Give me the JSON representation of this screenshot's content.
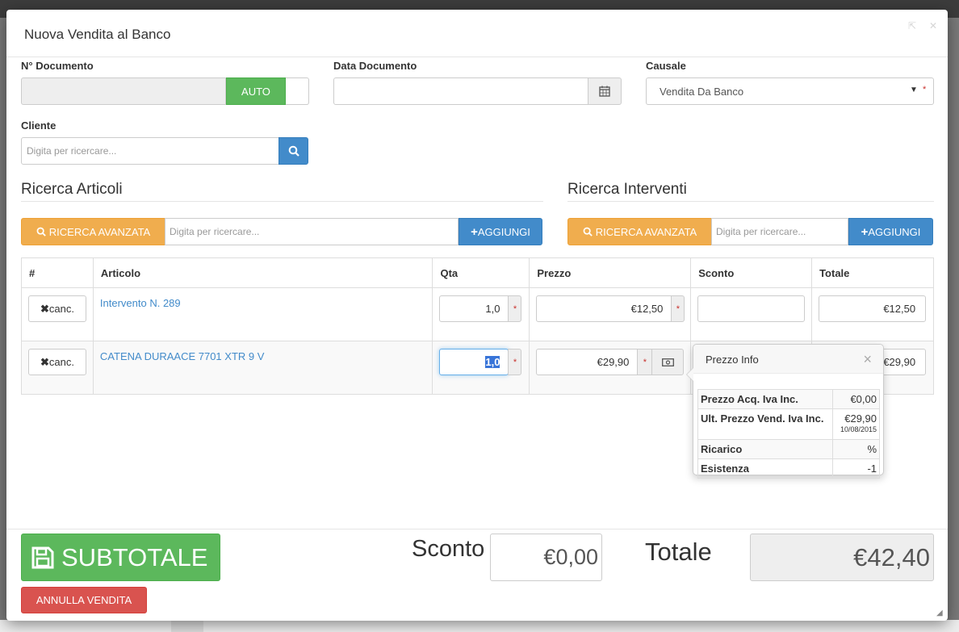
{
  "modal": {
    "title": "Nuova Vendita al Banco"
  },
  "form": {
    "doc_number_label": "N° Documento",
    "doc_number_value": "",
    "auto_label": "AUTO",
    "doc_date_label": "Data Documento",
    "doc_date_value": "",
    "causale_label": "Causale",
    "causale_value": "Vendita Da Banco",
    "required_mark": "*",
    "cliente_label": "Cliente",
    "cliente_placeholder": "Digita per ricercare..."
  },
  "articoli": {
    "title": "Ricerca Articoli",
    "search_button": "RICERCA AVANZATA",
    "placeholder": "Digita per ricercare...",
    "add_button": "AGGIUNGI"
  },
  "interventi": {
    "title": "Ricerca Interventi",
    "search_button": "RICERCA AVANZATA",
    "placeholder": "Digita per ricercare...",
    "add_button": "AGGIUNGI"
  },
  "table": {
    "headers": [
      "#",
      "Articolo",
      "Qta",
      "Prezzo",
      "Sconto",
      "Totale"
    ],
    "rows": [
      {
        "cancel": "canc.",
        "articolo": "Intervento N. 289",
        "qta": "1,0",
        "prezzo": "€12,50",
        "sconto": "",
        "totale": "€12,50"
      },
      {
        "cancel": "canc.",
        "articolo": "CATENA DURAACE 7701 XTR 9 V",
        "qta": "1,0",
        "prezzo": "€29,90",
        "sconto": "",
        "totale": "€29,90"
      }
    ]
  },
  "popover": {
    "title": "Prezzo Info",
    "rows": [
      {
        "label": "Prezzo Acq. Iva Inc.",
        "value": "€0,00"
      },
      {
        "label": "Ult. Prezzo Vend. Iva Inc.",
        "value": "€29,90",
        "sub": "10/08/2015"
      },
      {
        "label": "Ricarico",
        "value": "%"
      },
      {
        "label": "Esistenza",
        "value": "-1"
      }
    ]
  },
  "footer": {
    "subtotale": "SUBTOTALE",
    "annulla": "ANNULLA VENDITA",
    "sconto_label": "Sconto",
    "sconto_value": "€0,00",
    "totale_label": "Totale",
    "totale_value": "€42,40"
  },
  "colors": {
    "green": "#5cb85c",
    "blue": "#428bca",
    "orange": "#f0ad4e",
    "red": "#d9534f"
  }
}
